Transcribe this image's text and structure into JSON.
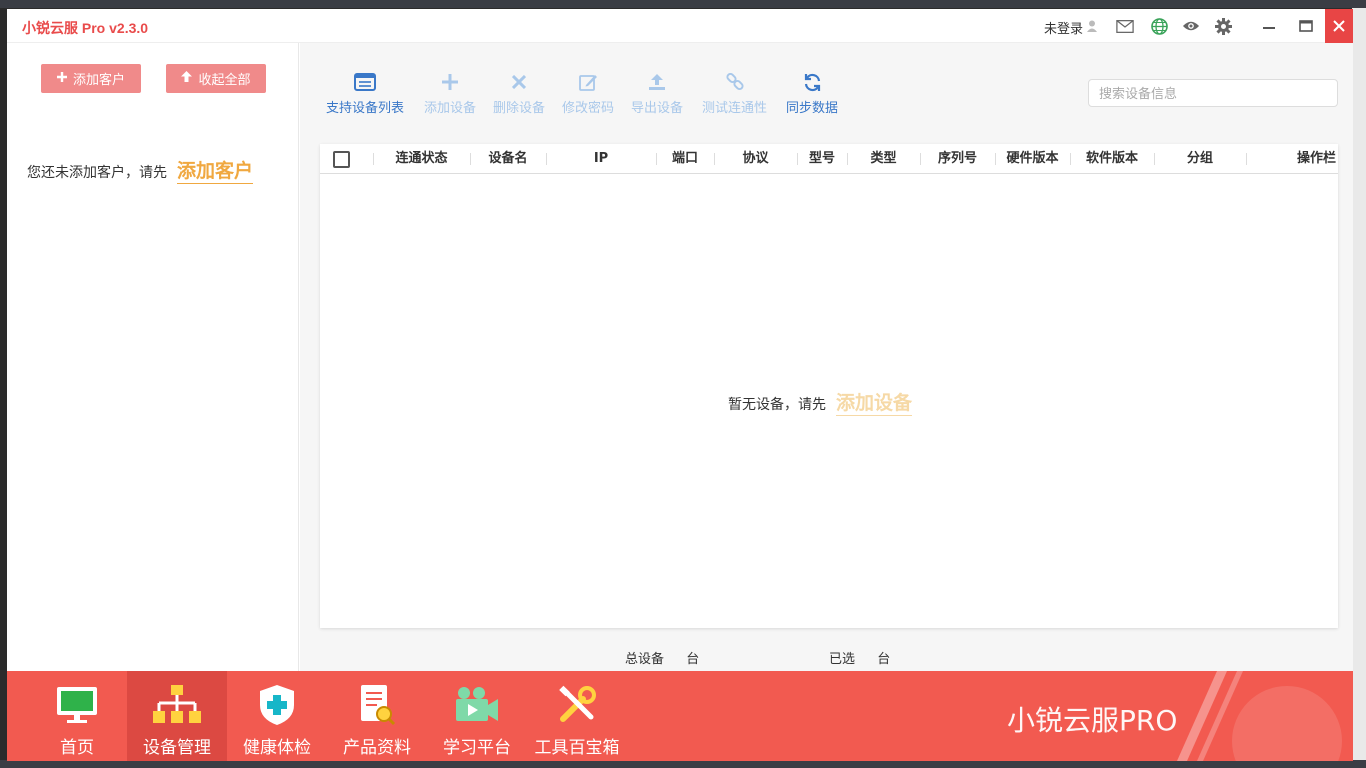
{
  "window": {
    "title": "小锐云服 Pro v2.3.0",
    "login_status": "未登录"
  },
  "sidebar": {
    "add_client_button": "添加客户",
    "collapse_all_button": "收起全部",
    "empty_prefix": "您还未添加客户，请先",
    "empty_link": "添加客户"
  },
  "toolbar": {
    "items": [
      {
        "label": "支持设备列表",
        "icon": "list-icon",
        "state": "active"
      },
      {
        "label": "添加设备",
        "icon": "plus-icon",
        "state": "disabled"
      },
      {
        "label": "删除设备",
        "icon": "x-icon",
        "state": "disabled"
      },
      {
        "label": "修改密码",
        "icon": "edit-icon",
        "state": "disabled"
      },
      {
        "label": "导出设备",
        "icon": "upload-icon",
        "state": "disabled"
      },
      {
        "label": "测试连通性",
        "icon": "link-icon",
        "state": "disabled"
      },
      {
        "label": "同步数据",
        "icon": "refresh-icon",
        "state": "active"
      }
    ],
    "search_placeholder": "搜索设备信息"
  },
  "table": {
    "columns": [
      "连通状态",
      "设备名",
      "IP",
      "端口",
      "协议",
      "型号",
      "类型",
      "序列号",
      "硬件版本",
      "软件版本",
      "分组",
      "操作栏"
    ],
    "empty_prefix": "暂无设备，请先",
    "empty_link": "添加设备"
  },
  "status_bar": {
    "total_label": "总设备",
    "total_unit": "台",
    "selected_label": "已选",
    "selected_unit": "台"
  },
  "bottom_nav": {
    "items": [
      {
        "label": "首页",
        "icon": "monitor-icon"
      },
      {
        "label": "设备管理",
        "icon": "org-chart-icon"
      },
      {
        "label": "健康体检",
        "icon": "shield-cross-icon"
      },
      {
        "label": "产品资料",
        "icon": "document-search-icon"
      },
      {
        "label": "学习平台",
        "icon": "video-camera-icon"
      },
      {
        "label": "工具百宝箱",
        "icon": "tools-icon"
      }
    ],
    "active_index": 1,
    "brand": "小锐云服PRO"
  },
  "colors": {
    "brand_red": "#f25a50",
    "title_red": "#e94b4b",
    "button_pink": "#f08a8a",
    "link_orange": "#f0a840",
    "toolbar_blue": "#3a78c8",
    "toolbar_disabled": "#a9c8ea"
  }
}
